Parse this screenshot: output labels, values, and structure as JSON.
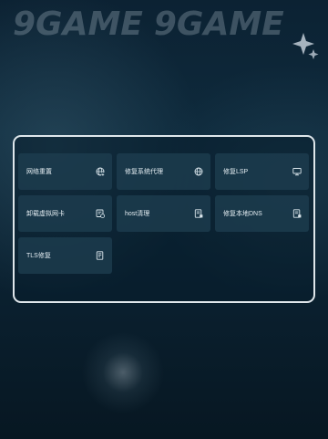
{
  "brand": {
    "logo_text": [
      "9GAME",
      "9GAME"
    ]
  },
  "colors": {
    "panel_border": "#ebf2f6",
    "tile_bg": "#1e3e50",
    "text": "#e4edf2"
  },
  "tools": [
    {
      "label": "网络重置",
      "icon": "globe-icon"
    },
    {
      "label": "修复系统代理",
      "icon": "globe-icon"
    },
    {
      "label": "修复LSP",
      "icon": "monitor-icon"
    },
    {
      "label": "卸载虚拟网卡",
      "icon": "network-card-icon"
    },
    {
      "label": "host清理",
      "icon": "document-icon"
    },
    {
      "label": "修复本地DNS",
      "icon": "document-icon"
    },
    {
      "label": "TLS修复",
      "icon": "document-list-icon"
    }
  ]
}
